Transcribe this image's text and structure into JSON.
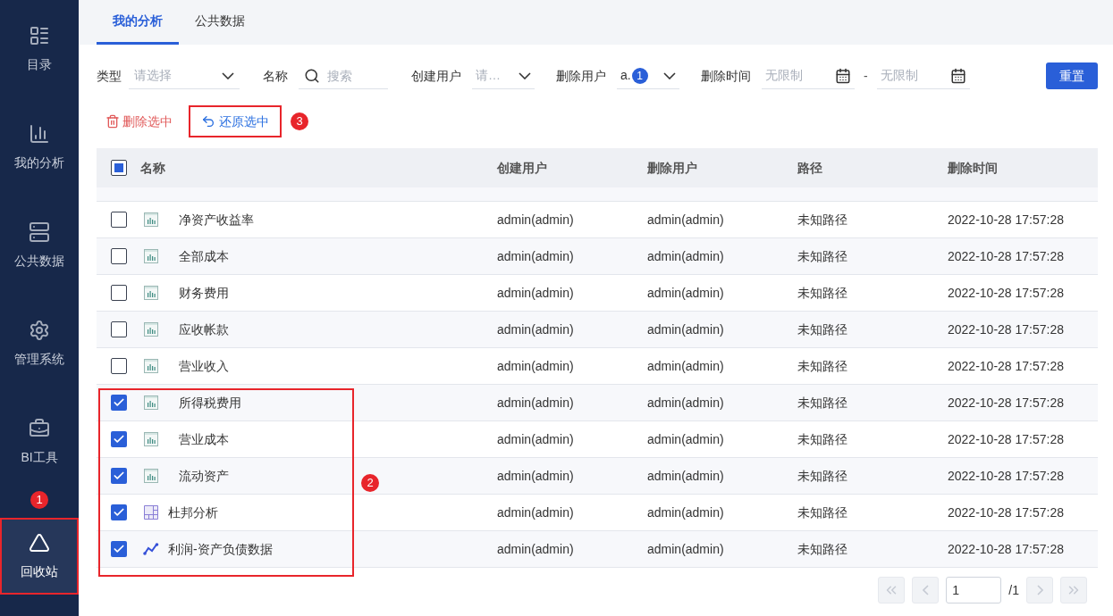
{
  "sidebar": {
    "items": [
      {
        "label": "目录",
        "selected": false
      },
      {
        "label": "我的分析",
        "selected": false
      },
      {
        "label": "公共数据",
        "selected": false
      },
      {
        "label": "管理系统",
        "selected": false
      },
      {
        "label": "BI工具",
        "selected": false
      },
      {
        "label": "回收站",
        "selected": true
      }
    ],
    "callout": "1"
  },
  "tabs": [
    {
      "label": "我的分析",
      "selected": true
    },
    {
      "label": "公共数据",
      "selected": false
    }
  ],
  "filters": {
    "type": {
      "label": "类型",
      "placeholder": "请选择"
    },
    "name": {
      "label": "名称",
      "placeholder": "搜索"
    },
    "creator": {
      "label": "创建用户",
      "placeholder": "请…"
    },
    "deleter": {
      "label": "删除用户",
      "value": "a.",
      "count": "1"
    },
    "time": {
      "label": "删除时间",
      "start_placeholder": "无限制",
      "separator": "-",
      "end_placeholder": "无限制"
    },
    "reset": "重置"
  },
  "actions": {
    "items": [
      {
        "kind": "delete",
        "label": "删除选中"
      },
      {
        "kind": "restore",
        "label": "还原选中"
      }
    ],
    "callout": "3"
  },
  "table": {
    "select_all_partial": true,
    "columns": [
      "名称",
      "创建用户",
      "删除用户",
      "路径",
      "删除时间"
    ],
    "callout": "2",
    "rows": [
      {
        "name": "净资产收益率",
        "kind": "bar",
        "created_by": "admin(admin)",
        "deleted_by": "admin(admin)",
        "path": "未知路径",
        "deleted_at": "2022-10-28 17:57:28",
        "checked": false
      },
      {
        "name": "全部成本",
        "kind": "bar",
        "created_by": "admin(admin)",
        "deleted_by": "admin(admin)",
        "path": "未知路径",
        "deleted_at": "2022-10-28 17:57:28",
        "checked": false
      },
      {
        "name": "财务费用",
        "kind": "bar",
        "created_by": "admin(admin)",
        "deleted_by": "admin(admin)",
        "path": "未知路径",
        "deleted_at": "2022-10-28 17:57:28",
        "checked": false
      },
      {
        "name": "应收帐款",
        "kind": "bar",
        "created_by": "admin(admin)",
        "deleted_by": "admin(admin)",
        "path": "未知路径",
        "deleted_at": "2022-10-28 17:57:28",
        "checked": false
      },
      {
        "name": "营业收入",
        "kind": "bar",
        "created_by": "admin(admin)",
        "deleted_by": "admin(admin)",
        "path": "未知路径",
        "deleted_at": "2022-10-28 17:57:28",
        "checked": false
      },
      {
        "name": "所得税费用",
        "kind": "bar",
        "created_by": "admin(admin)",
        "deleted_by": "admin(admin)",
        "path": "未知路径",
        "deleted_at": "2022-10-28 17:57:28",
        "checked": true
      },
      {
        "name": "营业成本",
        "kind": "bar",
        "created_by": "admin(admin)",
        "deleted_by": "admin(admin)",
        "path": "未知路径",
        "deleted_at": "2022-10-28 17:57:28",
        "checked": true
      },
      {
        "name": "流动资产",
        "kind": "bar",
        "created_by": "admin(admin)",
        "deleted_by": "admin(admin)",
        "path": "未知路径",
        "deleted_at": "2022-10-28 17:57:28",
        "checked": true
      },
      {
        "name": "杜邦分析",
        "kind": "dashboard",
        "created_by": "admin(admin)",
        "deleted_by": "admin(admin)",
        "path": "未知路径",
        "deleted_at": "2022-10-28 17:57:28",
        "checked": true
      },
      {
        "name": "利润-资产负债数据",
        "kind": "dataset",
        "created_by": "admin(admin)",
        "deleted_by": "admin(admin)",
        "path": "未知路径",
        "deleted_at": "2022-10-28 17:57:28",
        "checked": true
      }
    ]
  },
  "pagination": {
    "page": "1",
    "total": "/1"
  }
}
